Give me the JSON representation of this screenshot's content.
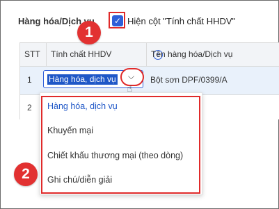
{
  "section": {
    "title": "Hàng hóa/Dịch vụ"
  },
  "option": {
    "checked": true,
    "label": "Hiện cột \"Tính chất HHDV\""
  },
  "annotations": {
    "step1": "1",
    "step2": "2",
    "accent": "#e23131"
  },
  "table": {
    "columns": [
      "STT",
      "Tính chất HHDV",
      "Tên hàng hóa/Dịch vụ"
    ],
    "rows": [
      {
        "stt": "1",
        "tinh_chat": "Hàng hóa, dịch vụ",
        "ten": "Bột sơn DPF/0399/A"
      },
      {
        "stt": "2",
        "tinh_chat": "",
        "ten": ""
      }
    ]
  },
  "dropdown": {
    "options": [
      "Hàng hóa, dịch vụ",
      "Khuyến mại",
      "Chiết khấu thương mại (theo dòng)",
      "Ghi chú/diễn giải"
    ],
    "selected_index": 0
  },
  "icons": {
    "info": "info-icon",
    "chevron": "chevron-down-icon",
    "cursor": "hand-cursor-icon",
    "check": "check-icon"
  },
  "colors": {
    "primary": "#2f5fd8",
    "highlight_red": "#e02a2a",
    "row_selected": "#e9f1fb"
  }
}
